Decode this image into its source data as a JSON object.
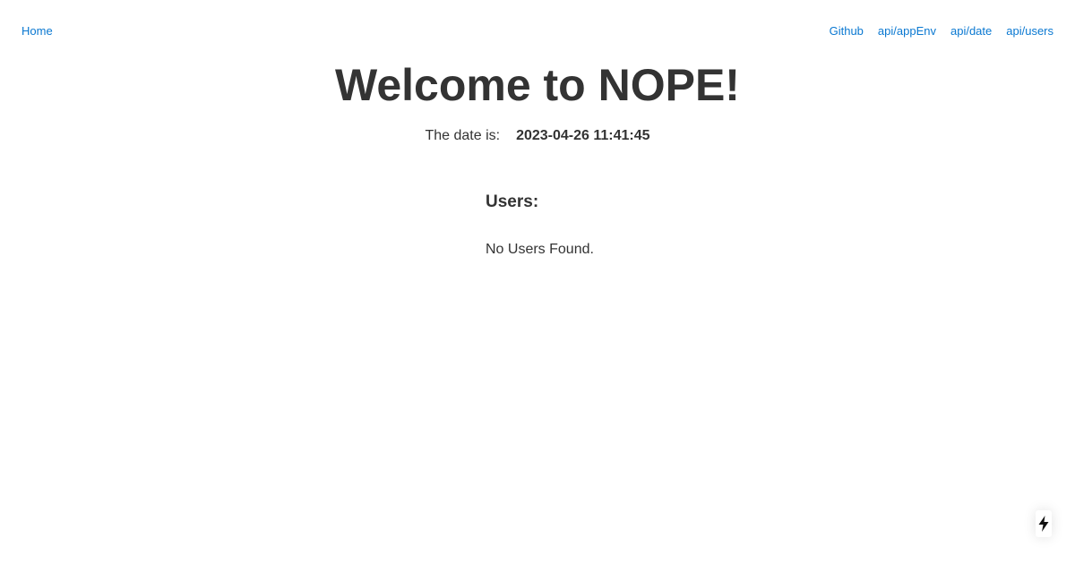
{
  "nav": {
    "home_label": "Home",
    "links": [
      {
        "label": "Github"
      },
      {
        "label": "api/appEnv"
      },
      {
        "label": "api/date"
      },
      {
        "label": "api/users"
      }
    ]
  },
  "main": {
    "title": "Welcome to NOPE!",
    "date_label": "The date is:",
    "date_value": "2023-04-26 11:41:45"
  },
  "users": {
    "heading": "Users:",
    "empty_message": "No Users Found."
  },
  "floating_button": {
    "icon": "lightning-bolt-icon"
  },
  "colors": {
    "link": "#0a78d1",
    "text": "#333333",
    "background": "#ffffff"
  }
}
